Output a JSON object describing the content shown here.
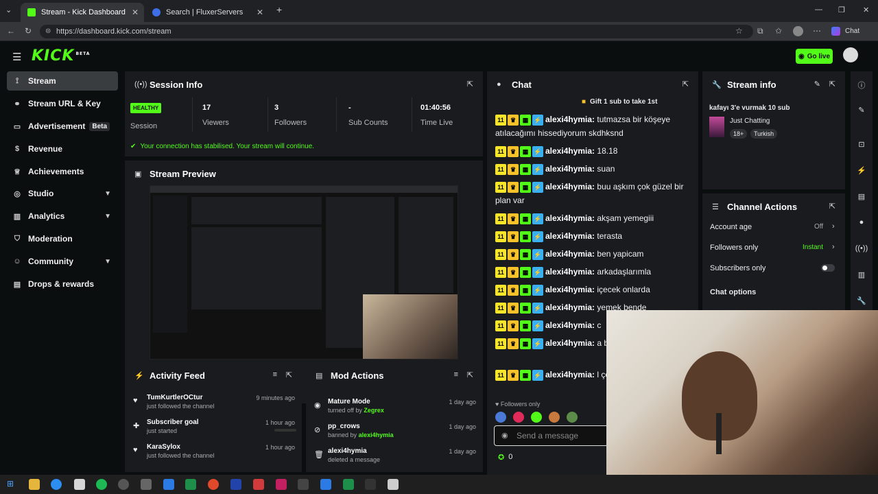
{
  "browser": {
    "tabs": [
      {
        "title": "Stream - Kick Dashboard"
      },
      {
        "title": "Search | FluxerServers"
      }
    ],
    "url": "https://dashboard.kick.com/stream",
    "chat_label": "Chat"
  },
  "app": {
    "logo": "KICK",
    "logo_sup": "BETA",
    "go_live": "Go live"
  },
  "sidebar": {
    "items": [
      {
        "label": "Stream",
        "icon": "stream-icon"
      },
      {
        "label": "Stream URL & Key",
        "icon": "link-icon"
      },
      {
        "label": "Advertisement",
        "badge": "Beta",
        "icon": "ad-icon"
      },
      {
        "label": "Revenue",
        "icon": "dollar-icon"
      },
      {
        "label": "Achievements",
        "icon": "trophy-icon"
      },
      {
        "label": "Studio",
        "icon": "studio-icon"
      },
      {
        "label": "Analytics",
        "icon": "chart-icon"
      },
      {
        "label": "Moderation",
        "icon": "shield-icon"
      },
      {
        "label": "Community",
        "icon": "users-icon"
      },
      {
        "label": "Drops & rewards",
        "icon": "gift-icon"
      }
    ]
  },
  "session": {
    "title": "Session Info",
    "health": "HEALTHY",
    "session_label": "Session",
    "viewers": "17",
    "viewers_label": "Viewers",
    "followers": "3",
    "followers_label": "Followers",
    "subs": "-",
    "subs_label": "Sub Counts",
    "time": "01:40:56",
    "time_label": "Time Live",
    "notice": "Your connection has stabilised. Your stream will continue."
  },
  "preview": {
    "title": "Stream Preview"
  },
  "activity": {
    "title": "Activity Feed",
    "items": [
      {
        "name": "TumKurtlerOCtur",
        "desc": "just followed the channel",
        "time": "9 minutes ago"
      },
      {
        "name": "Subscriber goal",
        "desc": "just started",
        "time": "1 hour ago"
      },
      {
        "name": "KaraSylox",
        "desc": "just followed the channel",
        "time": "1 hour ago"
      }
    ]
  },
  "mod": {
    "title": "Mod Actions",
    "items": [
      {
        "name": "Mature Mode",
        "desc": "turned off by",
        "actor": "Zegrex",
        "time": "1 day ago"
      },
      {
        "name": "pp_crows",
        "desc": "banned by",
        "actor": "alexi4hymia",
        "time": "1 day ago"
      },
      {
        "name": "alexi4hymia",
        "desc": "deleted a message",
        "actor": "",
        "time": "1 day ago"
      }
    ]
  },
  "chat": {
    "title": "Chat",
    "pinned": "Gift 1 sub to take 1st",
    "messages": [
      {
        "user": "alexi4hymia:",
        "text": "tutmazsa bir köşeye atılacağımı hissediyorum skdhksnd"
      },
      {
        "user": "alexi4hymia:",
        "text": "18.18"
      },
      {
        "user": "alexi4hymia:",
        "text": "suan"
      },
      {
        "user": "alexi4hymia:",
        "text": "buu aşkım çok güzel bir plan var"
      },
      {
        "user": "alexi4hymia:",
        "text": "akşam yemegiii"
      },
      {
        "user": "alexi4hymia:",
        "text": "terasta"
      },
      {
        "user": "alexi4hymia:",
        "text": "ben yapicam"
      },
      {
        "user": "alexi4hymia:",
        "text": "arkadaşlarımla"
      },
      {
        "user": "alexi4hymia:",
        "text": "içecek onlarda"
      },
      {
        "user": "alexi4hymia:",
        "text": "yemek bende"
      },
      {
        "user": "alexi4hymia:",
        "text": "c"
      },
      {
        "user": "alexi4hymia:",
        "text": "a bilmiyorum"
      },
      {
        "user": "alexi4hymia:",
        "text": "l çok judgelaniyorum"
      }
    ],
    "badge_num": "11",
    "followers_only": "Followers only",
    "placeholder": "Send a message",
    "points": "0"
  },
  "stream_info": {
    "title": "Stream info",
    "stream_title": "kafayı 3'e vurmak 10 sub",
    "category": "Just Chatting",
    "tags": [
      "18+",
      "Turkish"
    ]
  },
  "channel_actions": {
    "title": "Channel Actions",
    "rows": [
      {
        "label": "Account age",
        "value": "Off"
      },
      {
        "label": "Followers only",
        "value": "Instant"
      },
      {
        "label": "Subscribers only",
        "value": ""
      }
    ],
    "chat_options": "Chat options"
  },
  "colors": {
    "accent": "#53fc18",
    "panel": "#191b1f",
    "bg": "#0b0e0f"
  }
}
